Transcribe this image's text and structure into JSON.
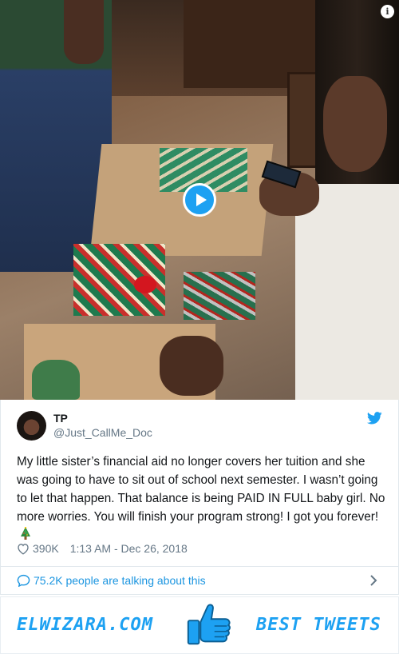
{
  "media": {
    "info_symbol": "i",
    "play_icon": "play-icon",
    "play_color": "#1da1f2"
  },
  "tweet": {
    "display_name": "TP",
    "handle": "@Just_CallMe_Doc",
    "text": "My little sister’s financial aid no longer covers her tuition and she was going to have to sit out of school next semester. I wasn’t going to let that happen. That balance is being PAID IN FULL baby girl. No more worries. You will finish your program strong! I got you forever!",
    "emoji_icon": "christmas-tree-icon",
    "likes": "390K",
    "timestamp": "1:13 AM - Dec 26, 2018"
  },
  "conversation": {
    "label": "75.2K people are talking about this"
  },
  "footer": {
    "left_brand": "ELWIZARA.COM",
    "right_brand": "BEST TWEETS",
    "accent": "#1da1f2"
  },
  "colors": {
    "link": "#1b95e0",
    "muted": "#657786",
    "text": "#14171a"
  }
}
